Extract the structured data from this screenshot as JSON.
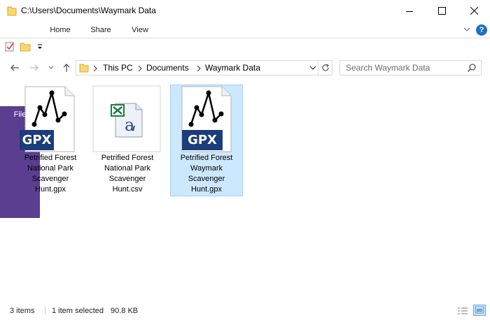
{
  "window": {
    "title": "C:\\Users\\Documents\\Waymark Data"
  },
  "ribbon": {
    "tabs": [
      "File",
      "Home",
      "Share",
      "View"
    ]
  },
  "navigation": {
    "breadcrumbs": [
      "This PC",
      "Documents",
      "Waymark Data"
    ]
  },
  "search": {
    "placeholder": "Search Waymark Data"
  },
  "files": [
    {
      "name": "Petrified Forest National Park Scavenger Hunt.gpx",
      "lines": [
        "Petrified Forest",
        "National Park",
        "Scavenger",
        "Hunt.gpx"
      ],
      "type": "gpx",
      "badge": "GPX",
      "selected": false
    },
    {
      "name": "Petrified Forest National Park Scavenger Hunt.csv",
      "lines": [
        "Petrified Forest",
        "National Park",
        "Scavenger",
        "Hunt.csv"
      ],
      "type": "csv",
      "selected": false
    },
    {
      "name": "Petrified Forest Waymark Scavenger Hunt.gpx",
      "lines": [
        "Petrified Forest",
        "Waymark",
        "Scavenger",
        "Hunt.gpx"
      ],
      "type": "gpx",
      "badge": "GPX",
      "selected": true
    }
  ],
  "status": {
    "item_count": "3 items",
    "selection": "1 item selected",
    "size": "90.8 KB"
  },
  "icons": {
    "help": "?"
  },
  "colors": {
    "file_tab": "#5b3e8f",
    "selection_bg": "#cce8ff",
    "selection_border": "#99d1ff",
    "gpx_badge": "#1c3c7a",
    "help": "#1f6fc5"
  }
}
